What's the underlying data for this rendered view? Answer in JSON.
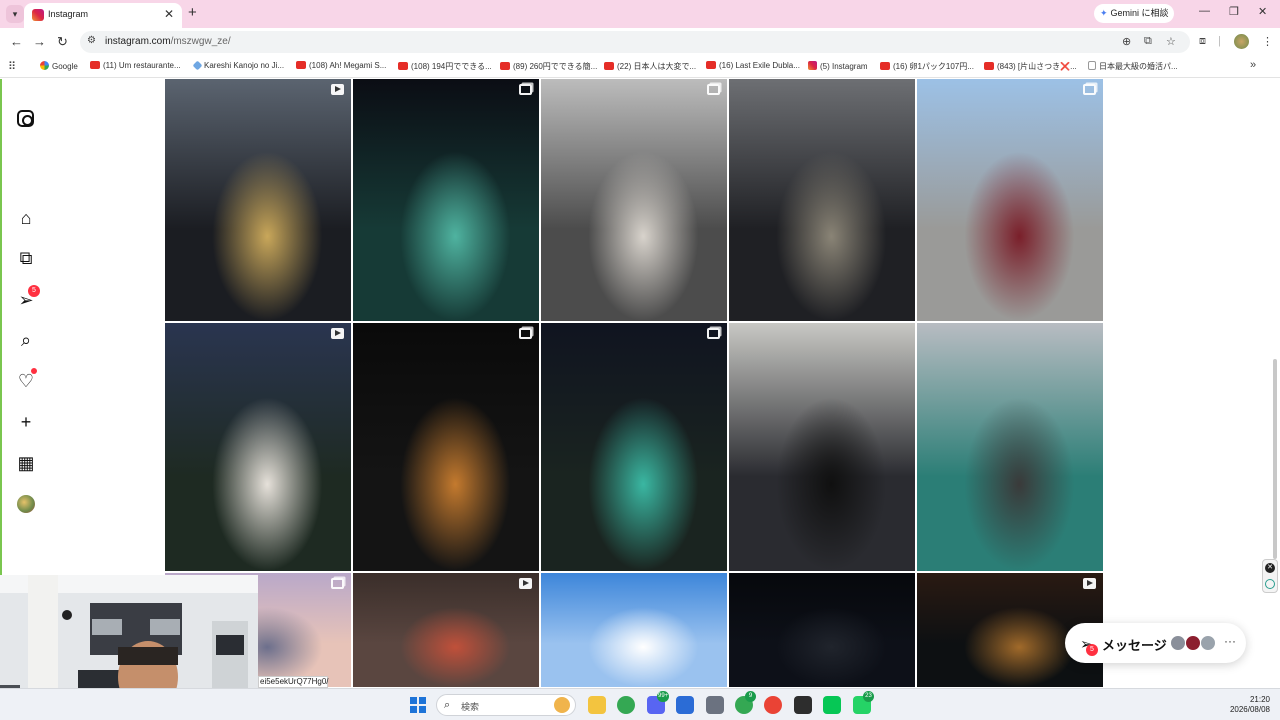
{
  "browser": {
    "tab": {
      "title": "Instagram",
      "close_glyph": "✕"
    },
    "new_tab_glyph": "+",
    "gemini_button": "Gemini に相談",
    "url_host": "instagram.com",
    "url_path": "/mszwgw_ze/",
    "bookmarks": [
      {
        "label": "Google",
        "icon": "google"
      },
      {
        "label": "(11) Um restaurante...",
        "icon": "youtube"
      },
      {
        "label": "Kareshi Kanojo no Ji...",
        "icon": "diamond"
      },
      {
        "label": "(108) Ah! Megami S...",
        "icon": "youtube"
      },
      {
        "label": "(108) 194円でできる...",
        "icon": "youtube"
      },
      {
        "label": "(89) 260円でできる簡...",
        "icon": "youtube"
      },
      {
        "label": "(22) 日本人は大変で...",
        "icon": "youtube"
      },
      {
        "label": "(16) Last Exile Dubla...",
        "icon": "youtube"
      },
      {
        "label": "(5) Instagram",
        "icon": "instagram"
      },
      {
        "label": "(16) 卵1パック107円...",
        "icon": "youtube"
      },
      {
        "label": "(843) [片山さつき❌...",
        "icon": "youtube"
      },
      {
        "label": "日本最大級の婚活パ...",
        "icon": "document"
      }
    ]
  },
  "instagram": {
    "sidebar": {
      "items": [
        {
          "name": "instagram-logo",
          "icon": "instagram-icon"
        },
        {
          "name": "home",
          "icon": "home-icon"
        },
        {
          "name": "reels",
          "icon": "reels-icon"
        },
        {
          "name": "messages",
          "icon": "messages-icon",
          "badge": "5"
        },
        {
          "name": "search",
          "icon": "search-icon"
        },
        {
          "name": "notifications",
          "icon": "heart-icon",
          "dot": true
        },
        {
          "name": "create",
          "icon": "plus-icon"
        },
        {
          "name": "insights",
          "icon": "chart-icon"
        },
        {
          "name": "profile",
          "icon": "avatar-icon"
        }
      ]
    },
    "grid": {
      "columns": 5,
      "posts": [
        {
          "type": "reel",
          "palette": [
            "#5b6470",
            "#1b1d22",
            "#c9a75a"
          ]
        },
        {
          "type": "multi",
          "palette": [
            "#0b0d14",
            "#163a36",
            "#4fb3a0"
          ]
        },
        {
          "type": "multi",
          "palette": [
            "#bcbcbc",
            "#4c4c4c",
            "#d8d3cc"
          ]
        },
        {
          "type": "none",
          "palette": [
            "#6d6f73",
            "#1f2024",
            "#8a8476"
          ]
        },
        {
          "type": "multi",
          "palette": [
            "#9cc1e6",
            "#9a9a98",
            "#7a1f2a"
          ]
        },
        {
          "type": "reel",
          "palette": [
            "#2a3550",
            "#1e2a22",
            "#e6e1da"
          ]
        },
        {
          "type": "multi",
          "palette": [
            "#0a0a0a",
            "#141414",
            "#c47a2e"
          ]
        },
        {
          "type": "multi",
          "palette": [
            "#101420",
            "#1a2420",
            "#3ab7a2"
          ]
        },
        {
          "type": "none",
          "palette": [
            "#c8c8c4",
            "#2a2b30",
            "#101010"
          ]
        },
        {
          "type": "none",
          "palette": [
            "#b8bcc2",
            "#2b7e76",
            "#3a3a3a"
          ]
        },
        {
          "type": "multi",
          "palette": [
            "#b9a8c9",
            "#e7c3b8",
            "#6c6f8c"
          ]
        },
        {
          "type": "reel",
          "palette": [
            "#3a2e2a",
            "#5a4640",
            "#c0503a"
          ]
        },
        {
          "type": "none",
          "palette": [
            "#3d86da",
            "#9ac2ef",
            "#ffffff"
          ]
        },
        {
          "type": "none",
          "palette": [
            "#06080c",
            "#0d1018",
            "#20242c"
          ]
        },
        {
          "type": "reel",
          "palette": [
            "#2a1a12",
            "#0d1012",
            "#a16a2a"
          ]
        }
      ]
    },
    "messages_pill": {
      "label": "メッセージ",
      "badge": "5",
      "more": "···"
    }
  },
  "webcam": {
    "caption": "ei5e5ekUrQ77Hg0/"
  },
  "taskbar": {
    "search_label": "検索",
    "apps": [
      {
        "name": "file-explorer",
        "color": "#f3c43f"
      },
      {
        "name": "chrome",
        "color": "#34a853"
      },
      {
        "name": "discord",
        "color": "#5865f2",
        "badge": "99+"
      },
      {
        "name": "photos",
        "color": "#2b6cd6"
      },
      {
        "name": "settings",
        "color": "#6b7280"
      },
      {
        "name": "chrome-profile-2",
        "color": "#34a853",
        "badge": "9"
      },
      {
        "name": "chrome-profile-3",
        "color": "#ea4335"
      },
      {
        "name": "obs",
        "color": "#2d2d2d"
      },
      {
        "name": "line",
        "color": "#06c755"
      },
      {
        "name": "whatsapp",
        "color": "#25d366",
        "badge": "23"
      }
    ],
    "time": "21:20",
    "date": "2026/08/08"
  },
  "colors": {
    "accent": "#f8d6e8",
    "notification": "#ff3040",
    "green_rail": "#7ac64f"
  }
}
